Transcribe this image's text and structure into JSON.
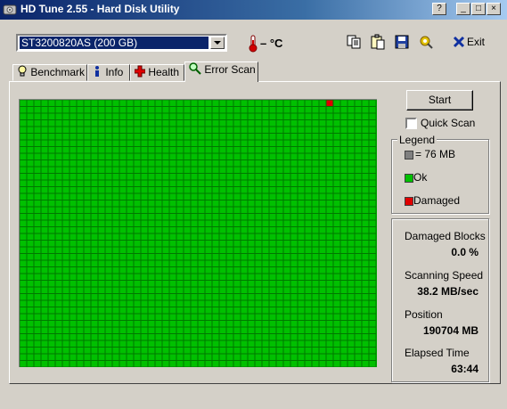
{
  "window": {
    "title": "HD Tune 2.55 - Hard Disk Utility",
    "controls": {
      "help": "?",
      "minimize": "_",
      "maximize": "□",
      "close": "×"
    }
  },
  "toolbar": {
    "drive": "ST3200820AS (200 GB)",
    "temperature": "– °C",
    "exit_label": "Exit",
    "icons": [
      "copy-icon",
      "copy-info-icon",
      "save-icon",
      "options-icon",
      "exit-icon"
    ]
  },
  "tabs": [
    {
      "label": "Benchmark",
      "icon": "lightbulb-icon"
    },
    {
      "label": "Info",
      "icon": "info-icon"
    },
    {
      "label": "Health",
      "icon": "health-cross-icon"
    },
    {
      "label": "Error Scan",
      "icon": "magnifier-icon",
      "active": true
    }
  ],
  "controls": {
    "start_label": "Start",
    "quick_scan_label": "Quick Scan",
    "quick_scan_checked": false
  },
  "legend": {
    "title": "Legend",
    "items": [
      {
        "label": "= 76 MB",
        "color": "#808080"
      },
      {
        "label": "Ok",
        "color": "#00c000"
      },
      {
        "label": "Damaged",
        "color": "#e00000"
      }
    ]
  },
  "stats": {
    "damaged_blocks_label": "Damaged Blocks",
    "damaged_blocks_value": "0.0 %",
    "scanning_speed_label": "Scanning Speed",
    "scanning_speed_value": "38.2 MB/sec",
    "position_label": "Position",
    "position_value": "190704 MB",
    "elapsed_time_label": "Elapsed Time",
    "elapsed_time_value": "63:44"
  },
  "scan_grid": {
    "columns": 50,
    "rows": 40,
    "ok_color": "#00c000",
    "line_color": "#007800",
    "damaged_color": "#e00000",
    "damaged_cells": [
      {
        "col": 43,
        "row": 0
      }
    ]
  }
}
